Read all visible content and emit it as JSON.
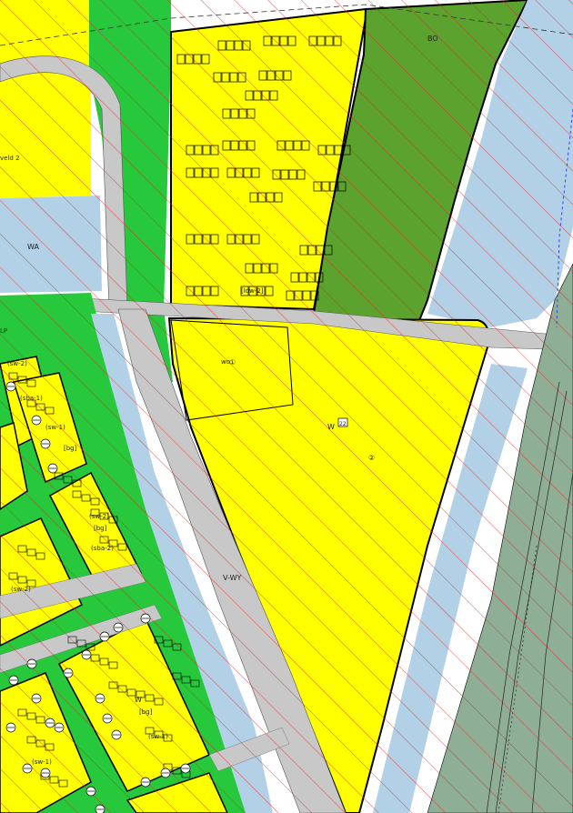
{
  "colors": {
    "residential_yellow": "#ffff00",
    "green_zone": "#28c83c",
    "forest_green": "#5ba32e",
    "water_blue": "#b3d1e6",
    "road_gray": "#c8c8c8",
    "railway_gray": "#8fae96",
    "hatch_red": "#e02020",
    "border_black": "#000000"
  },
  "labels": {
    "wonen": "W",
    "water": "WA",
    "verkeer": "V-WY",
    "bos": "BO",
    "tuin": "[bg]",
    "sw1": "(sw-1)",
    "sw2": "(sw-2)",
    "wonen_vlek": "wo",
    "veld": "veld 2",
    "lp": "LP",
    "sba": "(sba-1)",
    "sba2": "(sba-2)",
    "vbn": "[vbn]",
    "ldw": "[ldw-2]",
    "circ1": "①",
    "circ2": "②",
    "boxed": "22"
  }
}
